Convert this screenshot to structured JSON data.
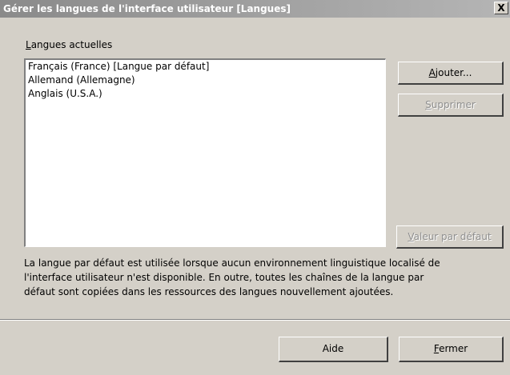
{
  "window": {
    "title": "Gérer les langues de l'interface utilisateur [Langues]",
    "close_label": "X"
  },
  "languages": {
    "label_mnemonic": "L",
    "label_rest": "angues actuelles",
    "items": [
      "Français (France) [Langue par défaut]",
      "Allemand (Allemagne)",
      "Anglais (U.S.A.)"
    ]
  },
  "buttons": {
    "add_mnemonic": "A",
    "add_rest": "jouter...",
    "remove_mnemonic": "S",
    "remove_rest": "upprimer",
    "default_mnemonic": "V",
    "default_rest": "aleur par défaut",
    "help_label": "Aide",
    "close_mnemonic": "F",
    "close_rest": "ermer"
  },
  "description": {
    "line1": "La langue par défaut est utilisée lorsque aucun environnement linguistique localisé de",
    "line2": "l'interface utilisateur n'est disponible. En outre, toutes les chaînes de la langue par",
    "line3": "défaut sont copiées dans les ressources des langues nouvellement ajoutées."
  }
}
